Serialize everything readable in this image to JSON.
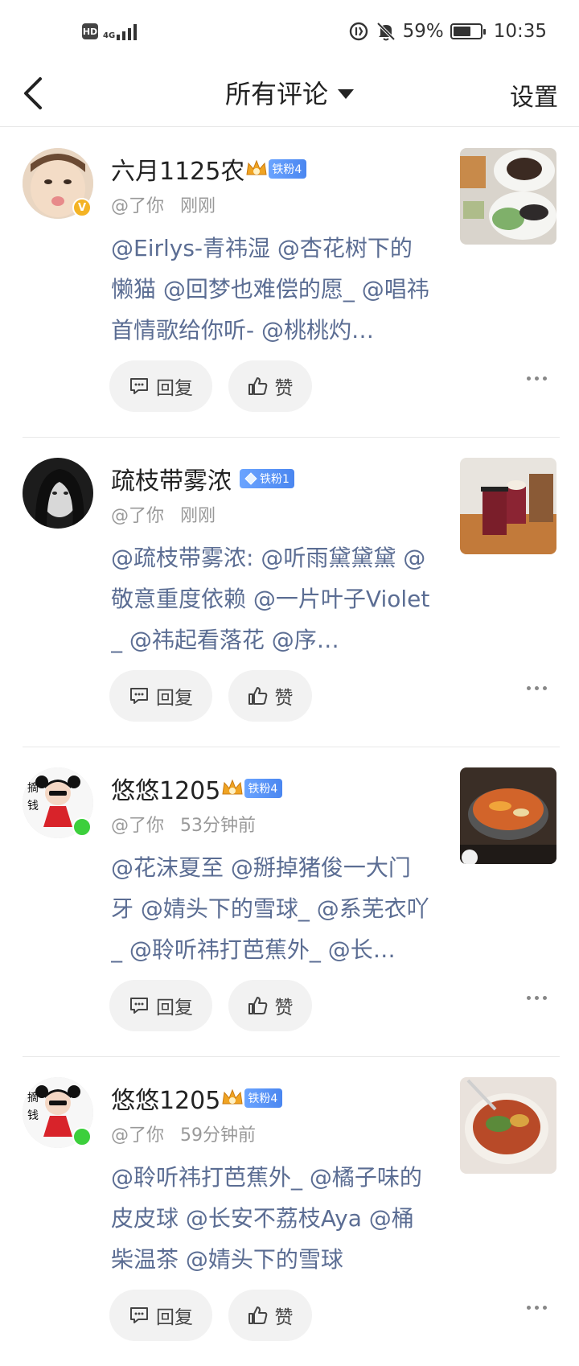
{
  "status_bar": {
    "hd": "HD",
    "net": "4G",
    "battery_percent": "59%",
    "battery_level": 0.59,
    "time": "10:35"
  },
  "nav": {
    "title": "所有评论",
    "settings_label": "设置"
  },
  "actions": {
    "reply_label": "回复",
    "like_label": "赞"
  },
  "comments": [
    {
      "user": "六月1125农",
      "fan_level": "铁粉4",
      "mention": "@了你",
      "time": "刚刚",
      "text": "@Eirlys-青祎湿 @杏花树下的懒猫 @回梦也难偿的愿_ @唱祎首情歌给你听- @桃桃灼…",
      "avatar_badge": "V"
    },
    {
      "user": "疏枝带雾浓",
      "fan_level": "铁粉1",
      "mention": "@了你",
      "time": "刚刚",
      "text": "@疏枝带雾浓: @听雨黛黛黛 @敬意重度依赖 @一片叶子Violet_ @祎起看落花 @序…",
      "avatar_badge": ""
    },
    {
      "user": "悠悠1205",
      "fan_level": "铁粉4",
      "mention": "@了你",
      "time": "53分钟前",
      "text": "@花沫夏至 @掰掉猪俊一大门牙 @婧头下的雪球_ @系芜衣吖_ @聆听祎打芭蕉外_ @长…",
      "avatar_badge": ""
    },
    {
      "user": "悠悠1205",
      "fan_level": "铁粉4",
      "mention": "@了你",
      "time": "59分钟前",
      "text": "@聆听祎打芭蕉外_ @橘子味的皮皮球 @长安不荔枝Aya @桶柴温茶 @婧头下的雪球",
      "avatar_badge": ""
    }
  ]
}
